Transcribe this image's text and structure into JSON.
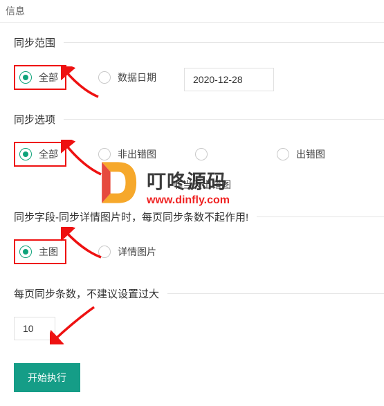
{
  "header": {
    "title": "信息"
  },
  "sections": {
    "scope": {
      "legend": "同步范围",
      "options": {
        "all": "全部",
        "date": "数据日期"
      },
      "date_value": "2020-12-28"
    },
    "options": {
      "legend": "同步选项",
      "options": {
        "all": "全部",
        "not_err": "非出错图",
        "err": "出错图",
        "not_today_err": "非当天出错图"
      }
    },
    "fields": {
      "legend": "同步字段-同步详情图片时，每页同步条数不起作用!",
      "options": {
        "main": "主图",
        "detail": "详情图片"
      }
    },
    "pagesize": {
      "legend": "每页同步条数，不建议设置过大",
      "value": "10"
    }
  },
  "submit": {
    "label": "开始执行"
  },
  "watermark": {
    "cn": "叮咚源码",
    "url": "www.dinfly.com"
  }
}
